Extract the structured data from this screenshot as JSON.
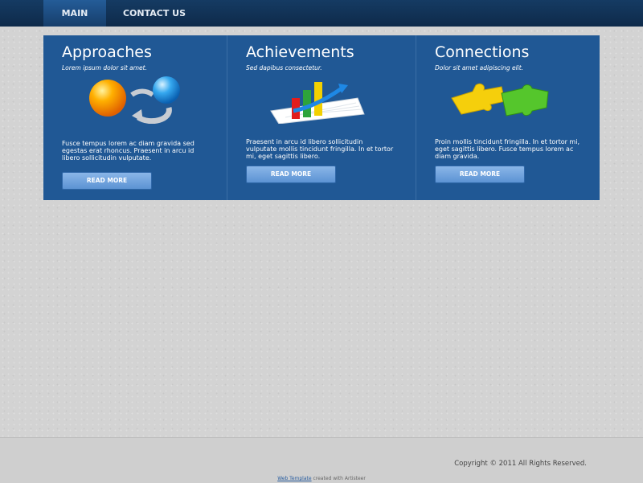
{
  "nav": {
    "main_label": "MAIN",
    "contact_label": "CONTACT US"
  },
  "columns": [
    {
      "title": "Approaches",
      "subtitle": "Lorem ipsum dolor sit amet.",
      "body": "Fusce tempus lorem ac diam gravida sed egestas erat rhoncus. Praesent in arcu id libero sollicitudin vulputate.",
      "button": "READ MORE",
      "icon": "spheres-cycle-icon"
    },
    {
      "title": "Achievements",
      "subtitle": "Sed dapibus consectetur.",
      "body": "Praesent in arcu id libero sollicitudin vulputate mollis tincidunt fringilla. In et tortor mi, eget sagittis libero.",
      "button": "READ MORE",
      "icon": "bar-chart-growth-icon"
    },
    {
      "title": "Connections",
      "subtitle": "Dolor sit amet adipiscing elit.",
      "body": "Proin mollis tincidunt fringilla. In et tortor mi, eget sagittis libero. Fusce tempus lorem ac diam gravida.",
      "button": "READ MORE",
      "icon": "puzzle-pieces-icon"
    }
  ],
  "footer": {
    "copyright": "Copyright © 2011 All Rights Reserved.",
    "credit_link": "Web Template",
    "credit_text": " created with Artisteer"
  },
  "colors": {
    "topbar": "#153b63",
    "panel": "#205895",
    "button": "#6fa3de",
    "background": "#d3d3d3"
  }
}
